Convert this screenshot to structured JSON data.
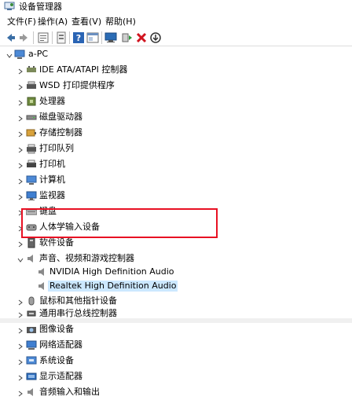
{
  "window": {
    "title": "设备管理器"
  },
  "menu": [
    "文件(F)",
    "操作(A)",
    "查看(V)",
    "帮助(H)"
  ],
  "toolbar": [
    "back-arrow",
    "forward-arrow",
    "properties-sheet",
    "update-driver",
    "help",
    "view-panel",
    "scan-hardware",
    "add-legacy",
    "uninstall",
    "disable"
  ],
  "tree": {
    "root": "a-PC",
    "categories": [
      "IDE ATA/ATAPI 控制器",
      "WSD 打印提供程序",
      "处理器",
      "磁盘驱动器",
      "存储控制器",
      "打印队列",
      "打印机",
      "计算机",
      "监视器",
      "键盘",
      "人体学输入设备",
      "软件设备",
      "声音、视频和游戏控制器"
    ],
    "audio_children": [
      "NVIDIA High Definition Audio",
      "Realtek High Definition Audio"
    ],
    "more_categories": [
      "鼠标和其他指针设备",
      "通用串行总线控制器",
      "图像设备",
      "网络适配器",
      "系统设备",
      "显示适配器",
      "音频输入和输出"
    ]
  },
  "colors": {
    "selection": "#cce8ff",
    "highlight_box": "#e81123"
  }
}
